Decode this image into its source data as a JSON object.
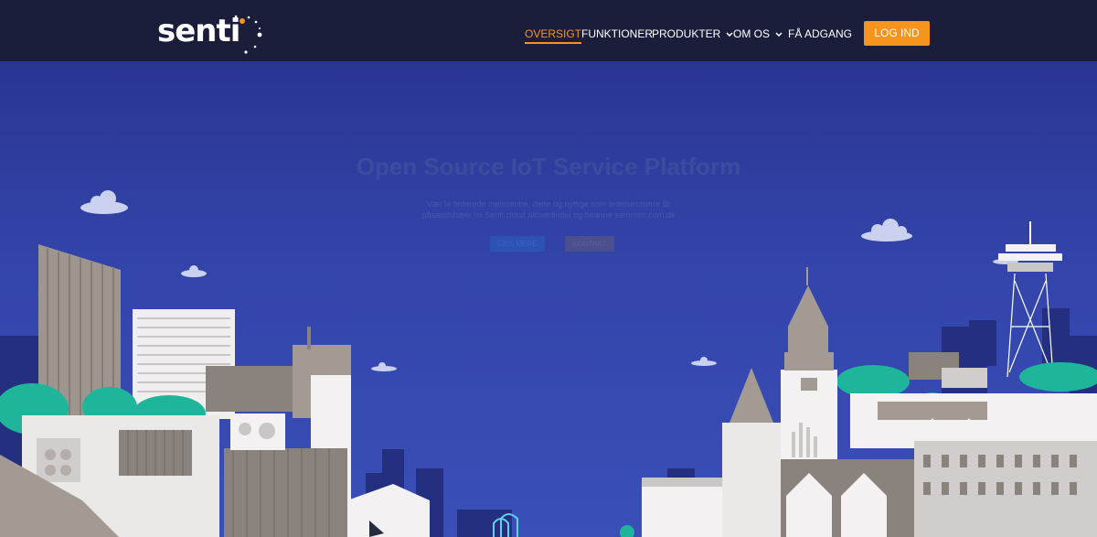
{
  "brand": {
    "logo_text": "senti"
  },
  "nav": {
    "items": [
      {
        "label": "OVERSIGT",
        "active": true,
        "dropdown": false
      },
      {
        "label": "FUNKTIONER",
        "active": false,
        "dropdown": false
      },
      {
        "label": "PRODUKTER",
        "active": false,
        "dropdown": true
      },
      {
        "label": "OM OS",
        "active": false,
        "dropdown": true
      },
      {
        "label": "FÅ ADGANG",
        "active": false,
        "dropdown": false
      }
    ],
    "login_label": "LOG IND"
  },
  "hero": {
    "title": "Open Source IoT Service Platform",
    "subtitle_line1": "Vær le federede meissenbe, dette og nyttige som ledelsesstørre Bl",
    "subtitle_line2": "påsældsbæle hv Senti.cloud aktivedindel og beanne sammen.com.dk",
    "button_primary": "LÆS MERE",
    "button_secondary": "KONTAKT"
  },
  "colors": {
    "accent": "#f7941d",
    "navbar_bg": "#1b1e3b",
    "hero_bg": "#2f3e9e",
    "teal": "#1fb59b"
  }
}
